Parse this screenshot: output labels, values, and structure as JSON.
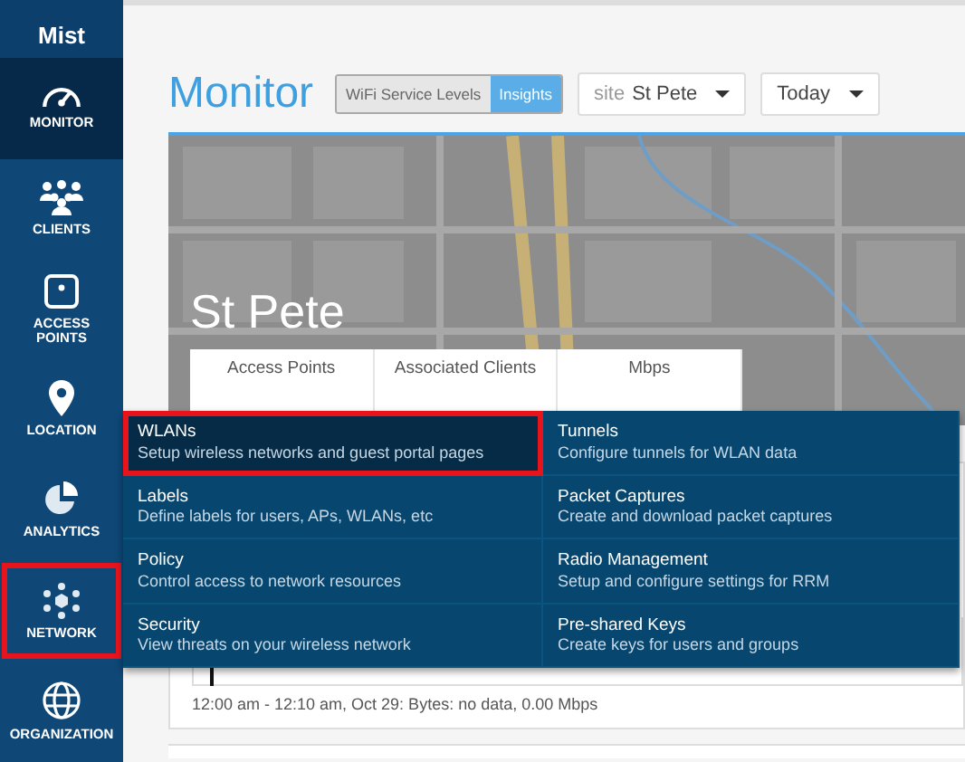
{
  "sidebar": {
    "logo": "Mist",
    "items": [
      {
        "label": "MONITOR",
        "selected": true,
        "annotated": false
      },
      {
        "label": "CLIENTS",
        "selected": false,
        "annotated": false
      },
      {
        "label": "ACCESS POINTS",
        "selected": false,
        "annotated": false
      },
      {
        "label": "LOCATION",
        "selected": false,
        "annotated": false
      },
      {
        "label": "ANALYTICS",
        "selected": false,
        "annotated": false
      },
      {
        "label": "NETWORK",
        "selected": false,
        "annotated": true
      },
      {
        "label": "ORGANIZATION",
        "selected": false,
        "annotated": false
      }
    ]
  },
  "header": {
    "title": "Monitor",
    "toggle": [
      {
        "label": "WiFi Service Levels",
        "selected": false
      },
      {
        "label": "Insights",
        "selected": true
      }
    ],
    "site_select": {
      "prefix": "site",
      "value": "St Pete"
    },
    "period_select": {
      "value": "Today"
    }
  },
  "site": {
    "name": "St Pete",
    "stats": [
      {
        "label": "Access Points"
      },
      {
        "label": "Associated Clients"
      },
      {
        "label": "Mbps"
      }
    ]
  },
  "network_menu": [
    {
      "title": "WLANs",
      "description": "Setup wireless networks and guest portal pages",
      "selected": true,
      "annotated": true
    },
    {
      "title": "Tunnels",
      "description": "Configure tunnels for WLAN data",
      "selected": false,
      "annotated": false
    },
    {
      "title": "Labels",
      "description": "Define labels for users, APs, WLANs, etc",
      "selected": false,
      "annotated": false
    },
    {
      "title": "Packet Captures",
      "description": "Create and download packet captures",
      "selected": false,
      "annotated": false
    },
    {
      "title": "Policy",
      "description": "Control access to network resources",
      "selected": false,
      "annotated": false
    },
    {
      "title": "Radio Management",
      "description": "Setup and configure settings for RRM",
      "selected": false,
      "annotated": false
    },
    {
      "title": "Security",
      "description": "View threats on your wireless network",
      "selected": false,
      "annotated": false
    },
    {
      "title": "Pre-shared Keys",
      "description": "Create keys for users and groups",
      "selected": false,
      "annotated": false
    }
  ],
  "chart_caption": "12:00 am - 12:10 am, Oct 29: Bytes: no data, 0.00 Mbps"
}
